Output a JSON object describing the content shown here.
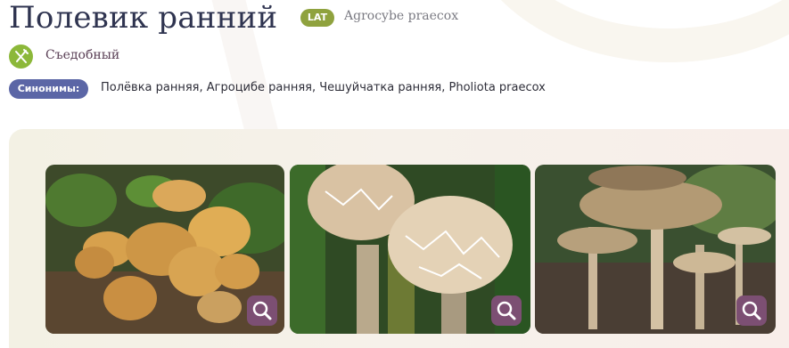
{
  "mushroom": {
    "title": "Полевик ранний",
    "lat_badge": "LAT",
    "latin_name": "Agrocybe praecox",
    "edibility": "Съедобный",
    "synonyms_label": "Синонимы:",
    "synonyms": "Полёвка ранняя, Агроцибе ранняя, Чешуйчатка ранняя, Pholiota praecox"
  },
  "colors": {
    "title": "#2f3450",
    "lat_badge": "#8fa23e",
    "edible_icon": "#8cb83a",
    "synonyms_badge": "#5b66a6",
    "zoom_button": "#7c4f73"
  },
  "gallery": {
    "photos": [
      {
        "subject": "cluster of orange-brown mushroom caps among green leaves"
      },
      {
        "subject": "two pale cracked mushroom caps in grass"
      },
      {
        "subject": "tall slender mushrooms with brown gills in forest"
      }
    ],
    "zoom_icon": "magnifier-icon"
  }
}
